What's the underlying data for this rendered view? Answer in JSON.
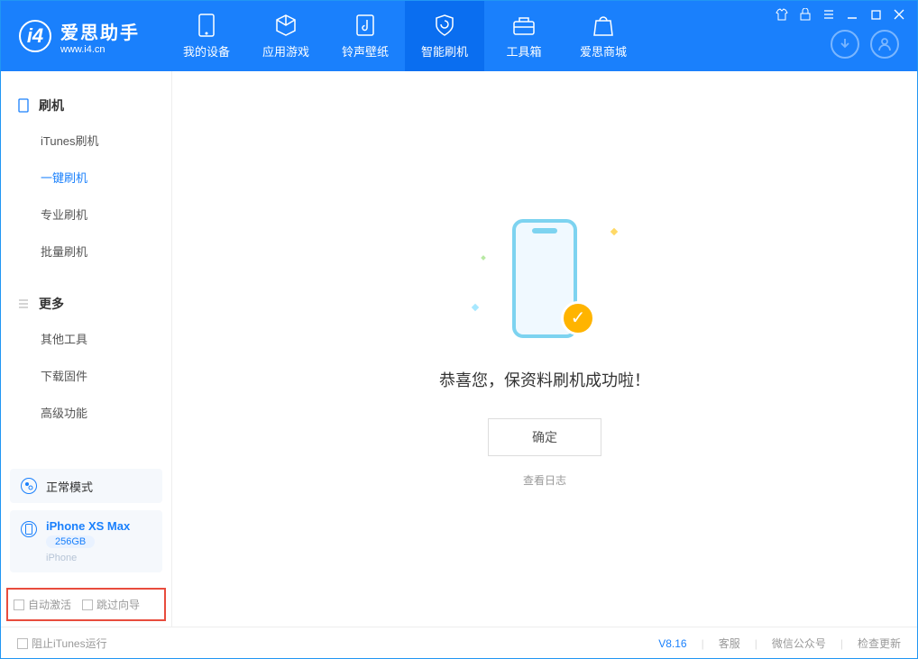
{
  "app": {
    "title": "爱思助手",
    "subtitle": "www.i4.cn"
  },
  "tabs": [
    {
      "label": "我的设备"
    },
    {
      "label": "应用游戏"
    },
    {
      "label": "铃声壁纸"
    },
    {
      "label": "智能刷机"
    },
    {
      "label": "工具箱"
    },
    {
      "label": "爱思商城"
    }
  ],
  "sidebar": {
    "group1_title": "刷机",
    "group1_items": [
      {
        "label": "iTunes刷机"
      },
      {
        "label": "一键刷机"
      },
      {
        "label": "专业刷机"
      },
      {
        "label": "批量刷机"
      }
    ],
    "group2_title": "更多",
    "group2_items": [
      {
        "label": "其他工具"
      },
      {
        "label": "下载固件"
      },
      {
        "label": "高级功能"
      }
    ],
    "mode_label": "正常模式",
    "device_name": "iPhone XS Max",
    "device_storage": "256GB",
    "device_type": "iPhone",
    "check1": "自动激活",
    "check2": "跳过向导"
  },
  "main": {
    "success_text": "恭喜您，保资料刷机成功啦！",
    "ok_button": "确定",
    "view_log": "查看日志"
  },
  "footer": {
    "block_itunes": "阻止iTunes运行",
    "version": "V8.16",
    "link1": "客服",
    "link2": "微信公众号",
    "link3": "检查更新"
  }
}
